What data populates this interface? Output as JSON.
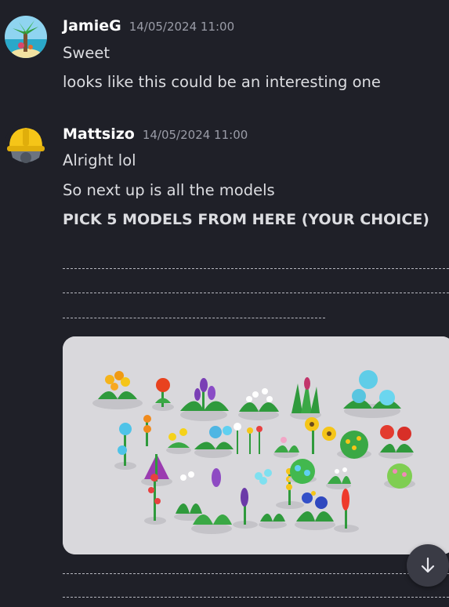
{
  "messages": [
    {
      "author": "JamieG",
      "timestamp": "14/05/2024 11:00",
      "lines": [
        "Sweet",
        "looks like this could be an interesting one"
      ]
    },
    {
      "author": "Mattsizo",
      "timestamp": "14/05/2024 11:00",
      "lines": [
        "Alright lol",
        "So next up is all the models",
        "PICK 5 MODELS FROM HERE (YOUR CHOICE)"
      ]
    }
  ],
  "icons": {
    "jamie_avatar": "tropical-island-avatar",
    "matt_avatar": "hardhat-avatar",
    "scroll": "arrow-down-icon"
  },
  "colors": {
    "background": "#1f2028",
    "text": "#dcdde1",
    "timestamp": "#9a9ca7",
    "image_bg": "#d9d8dc"
  }
}
